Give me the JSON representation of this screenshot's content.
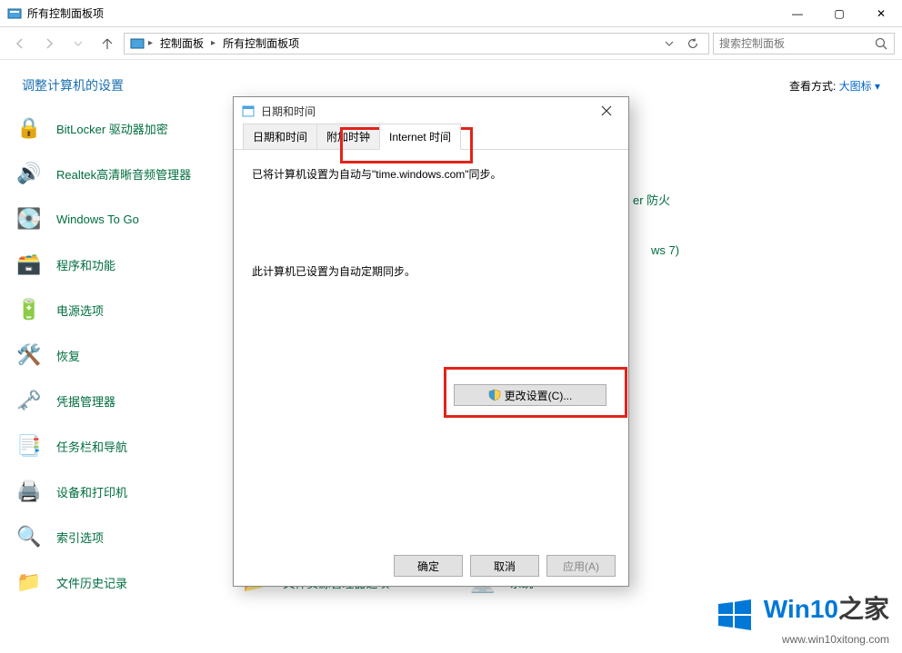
{
  "window": {
    "title": "所有控制面板项",
    "controls": {
      "min": "—",
      "max": "▢",
      "close": "✕"
    }
  },
  "nav": {
    "breadcrumb": [
      "控制面板",
      "所有控制面板项"
    ],
    "search_placeholder": "搜索控制面板"
  },
  "header": {
    "title": "调整计算机的设置",
    "view_label": "查看方式:",
    "view_value": "大图标 ▾"
  },
  "items_col1": [
    {
      "label": "BitLocker 驱动器加密",
      "icon": "🔒"
    },
    {
      "label": "Realtek高清晰音频管理器",
      "icon": "🔊"
    },
    {
      "label": "Windows To Go",
      "icon": "💽"
    },
    {
      "label": "程序和功能",
      "icon": "🗃️"
    },
    {
      "label": "电源选项",
      "icon": "🔋"
    },
    {
      "label": "恢复",
      "icon": "🛠️"
    },
    {
      "label": "凭据管理器",
      "icon": "🗝️"
    },
    {
      "label": "任务栏和导航",
      "icon": "📑"
    },
    {
      "label": "设备和打印机",
      "icon": "🖨️"
    },
    {
      "label": "索引选项",
      "icon": "🔍"
    },
    {
      "label": "文件历史记录",
      "icon": "📁"
    }
  ],
  "items_col2": [
    {
      "label": "文件资源管理器选项",
      "icon": "📂"
    }
  ],
  "items_col3": [
    {
      "label": "系统",
      "icon": "💻"
    }
  ],
  "partial_right": [
    "er 防火",
    "ws 7)"
  ],
  "dialog": {
    "title": "日期和时间",
    "tabs": [
      "日期和时间",
      "附加时钟",
      "Internet 时间"
    ],
    "active_tab": 2,
    "body_line1": "已将计算机设置为自动与\"time.windows.com\"同步。",
    "body_line2": "此计算机已设置为自动定期同步。",
    "change_btn": "更改设置(C)...",
    "ok": "确定",
    "cancel": "取消",
    "apply": "应用(A)"
  },
  "watermark": {
    "brand_a": "Win10",
    "brand_b": "之家",
    "url": "www.win10xitong.com"
  }
}
